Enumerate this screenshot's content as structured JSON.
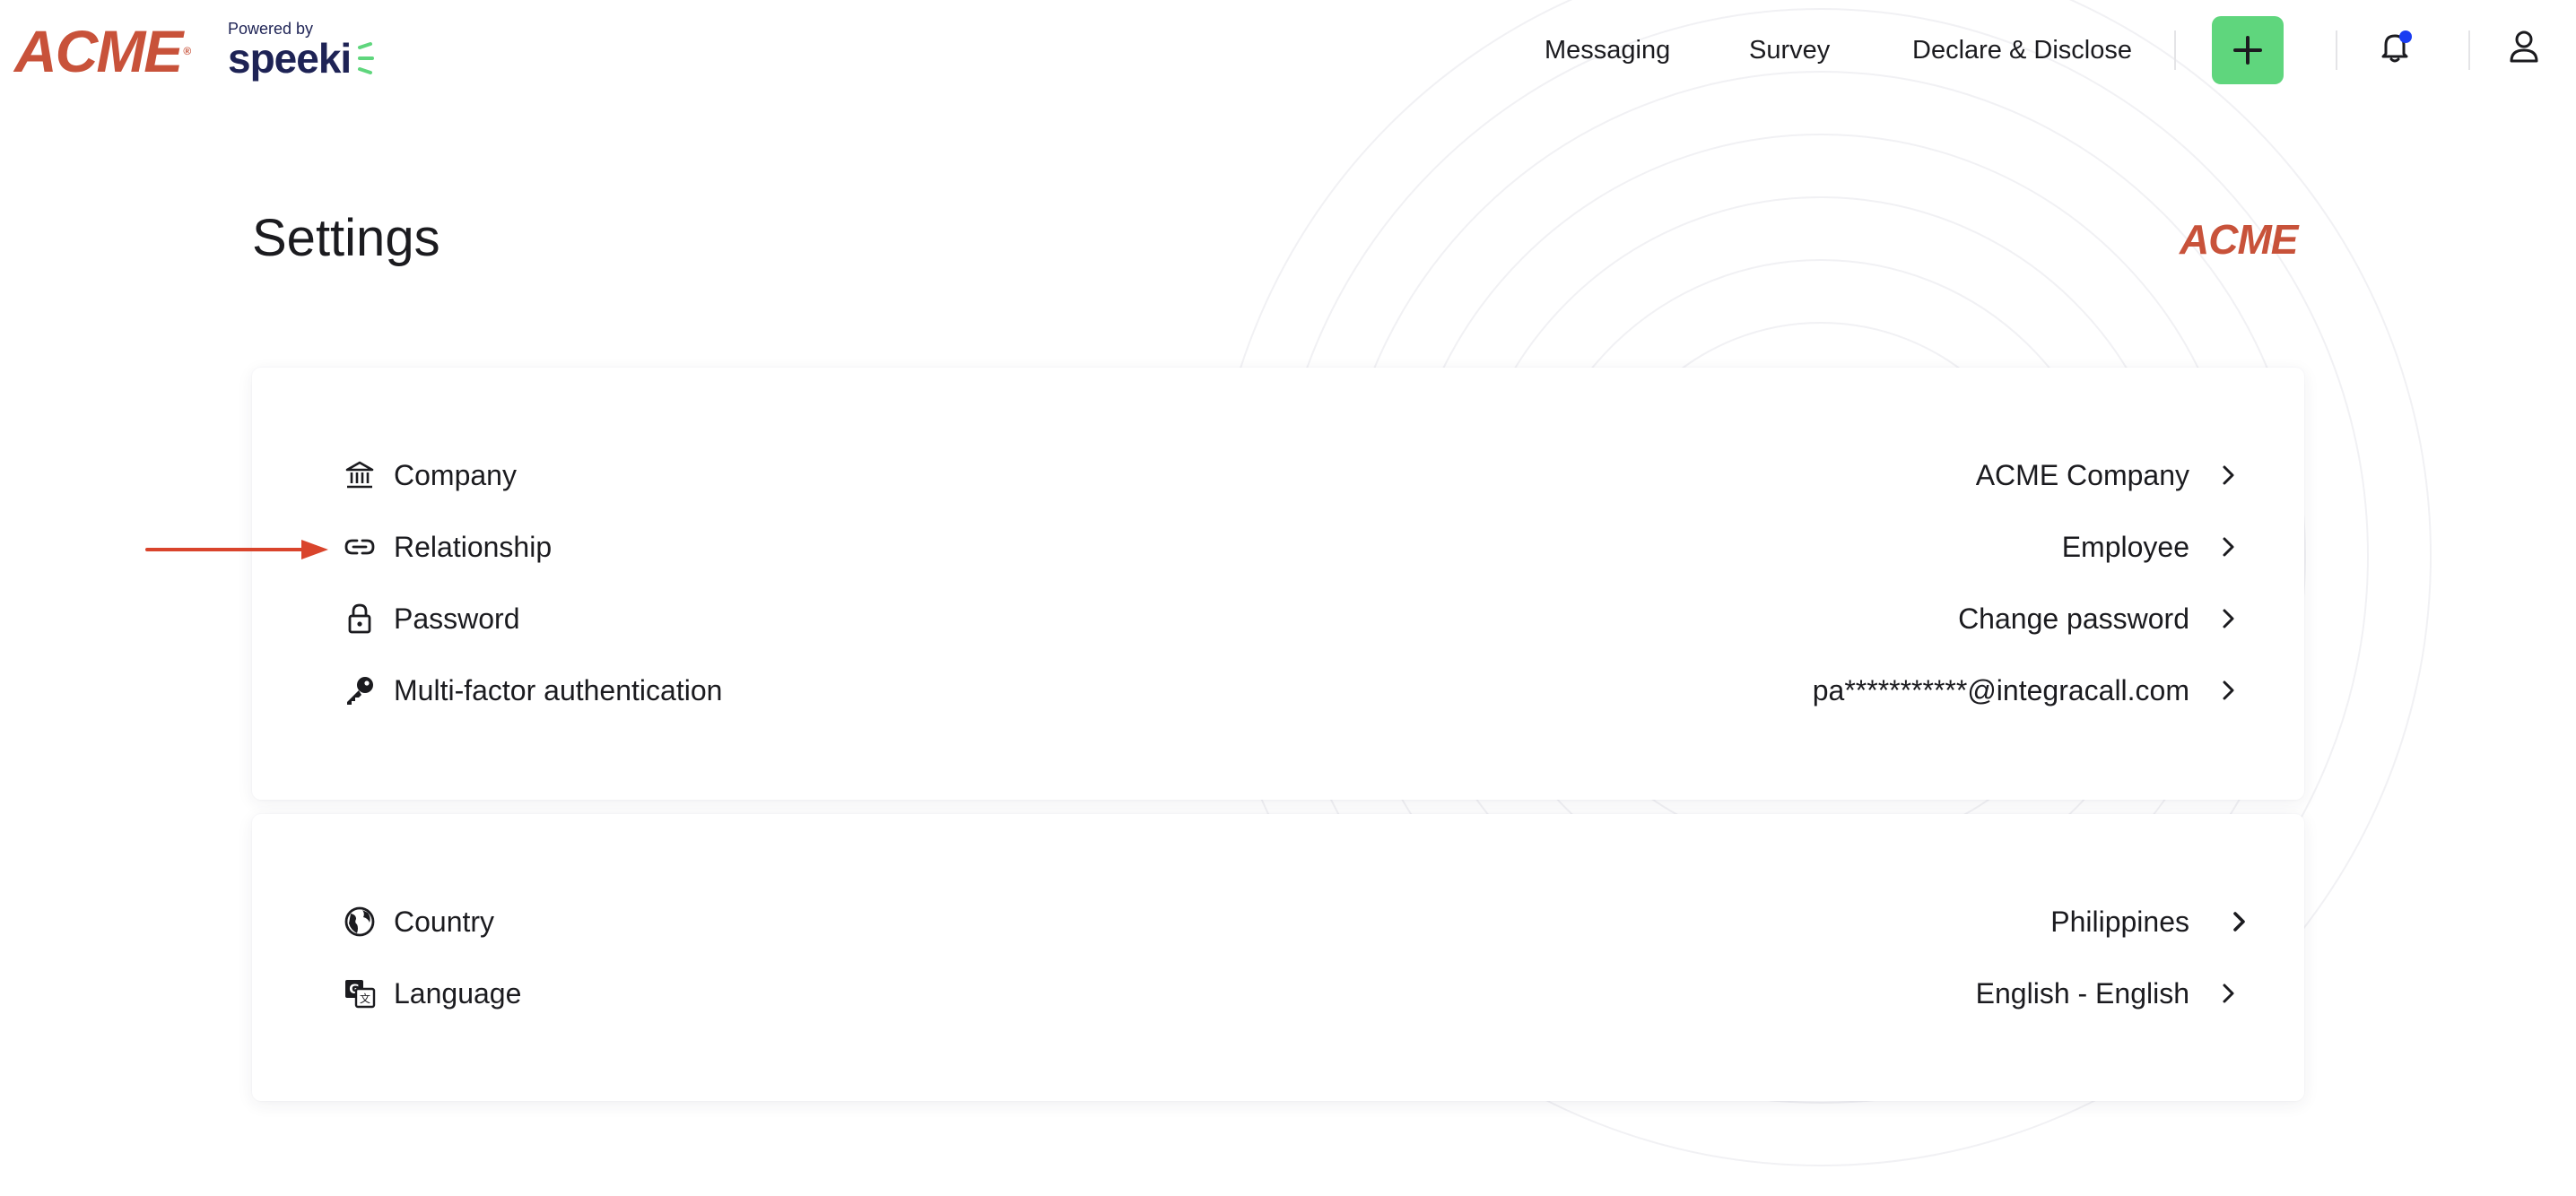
{
  "brand": {
    "logo_text": "ACME",
    "powered_by": "Powered by",
    "speeki": "speeki",
    "brand_color": "#c8523a",
    "accent_green": "#5fd67d"
  },
  "nav": {
    "messaging": "Messaging",
    "survey": "Survey",
    "declare": "Declare & Disclose",
    "add_icon": "plus-icon",
    "notification_icon": "bell-icon",
    "profile_icon": "user-icon",
    "notification_dot_color": "#1a3cf2"
  },
  "page": {
    "title": "Settings",
    "company_logo": "ACME"
  },
  "account_settings": [
    {
      "icon": "bank-icon",
      "label": "Company",
      "value": "ACME Company"
    },
    {
      "icon": "link-icon",
      "label": "Relationship",
      "value": "Employee"
    },
    {
      "icon": "lock-icon",
      "label": "Password",
      "value": "Change password"
    },
    {
      "icon": "key-icon",
      "label": "Multi-factor authentication",
      "value": "pa***********@integracall.com"
    }
  ],
  "locale_settings": [
    {
      "icon": "globe-icon",
      "label": "Country",
      "value": "Philippines"
    },
    {
      "icon": "translate-icon",
      "label": "Language",
      "value": "English - English"
    }
  ],
  "annotation": {
    "arrow_color": "#d9442c"
  }
}
